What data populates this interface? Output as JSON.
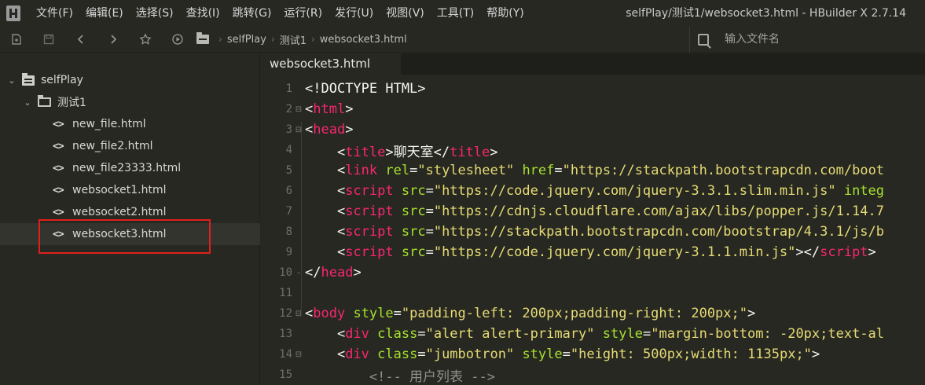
{
  "menubar": {
    "items": [
      "文件(F)",
      "编辑(E)",
      "选择(S)",
      "查找(I)",
      "跳转(G)",
      "运行(R)",
      "发行(U)",
      "视图(V)",
      "工具(T)",
      "帮助(Y)"
    ],
    "window_title": "selfPlay/测试1/websocket3.html - HBuilder X 2.7.14"
  },
  "toolbar": {
    "breadcrumbs": [
      "selfPlay",
      "测试1",
      "websocket3.html"
    ],
    "search_placeholder": "输入文件名"
  },
  "sidebar": {
    "project": "selfPlay",
    "folder": "测试1",
    "files": [
      "new_file.html",
      "new_file2.html",
      "new_file23333.html",
      "websocket1.html",
      "websocket2.html",
      "websocket3.html"
    ],
    "selected_file": "websocket3.html"
  },
  "editor": {
    "tab_label": "websocket3.html",
    "lines": [
      {
        "n": "1",
        "fold": "",
        "tokens": [
          [
            "doc",
            "<!DOCTYPE HTML>"
          ]
        ]
      },
      {
        "n": "2",
        "fold": "⊟",
        "tokens": [
          [
            "txt",
            "<"
          ],
          [
            "tag",
            "html"
          ],
          [
            "txt",
            ">"
          ]
        ]
      },
      {
        "n": "3",
        "fold": "⊟",
        "tokens": [
          [
            "txt",
            "<"
          ],
          [
            "tag",
            "head"
          ],
          [
            "txt",
            ">"
          ]
        ]
      },
      {
        "n": "4",
        "fold": "",
        "tokens": [
          [
            "txt",
            "    <"
          ],
          [
            "tag",
            "title"
          ],
          [
            "txt",
            ">聊天室</"
          ],
          [
            "tag",
            "title"
          ],
          [
            "txt",
            ">"
          ]
        ]
      },
      {
        "n": "5",
        "fold": "",
        "tokens": [
          [
            "txt",
            "    <"
          ],
          [
            "tag",
            "link"
          ],
          [
            "txt",
            " "
          ],
          [
            "attr",
            "rel"
          ],
          [
            "txt",
            "="
          ],
          [
            "str",
            "\"stylesheet\""
          ],
          [
            "txt",
            " "
          ],
          [
            "attr",
            "href"
          ],
          [
            "txt",
            "="
          ],
          [
            "str",
            "\"https://stackpath.bootstrapcdn.com/boot"
          ]
        ]
      },
      {
        "n": "6",
        "fold": "",
        "tokens": [
          [
            "txt",
            "    <"
          ],
          [
            "tag",
            "script"
          ],
          [
            "txt",
            " "
          ],
          [
            "attr",
            "src"
          ],
          [
            "txt",
            "="
          ],
          [
            "str",
            "\"https://code.jquery.com/jquery-3.3.1.slim.min.js\""
          ],
          [
            "txt",
            " "
          ],
          [
            "attr",
            "integ"
          ]
        ]
      },
      {
        "n": "7",
        "fold": "",
        "tokens": [
          [
            "txt",
            "    <"
          ],
          [
            "tag",
            "script"
          ],
          [
            "txt",
            " "
          ],
          [
            "attr",
            "src"
          ],
          [
            "txt",
            "="
          ],
          [
            "str",
            "\"https://cdnjs.cloudflare.com/ajax/libs/popper.js/1.14.7"
          ]
        ]
      },
      {
        "n": "8",
        "fold": "",
        "tokens": [
          [
            "txt",
            "    <"
          ],
          [
            "tag",
            "script"
          ],
          [
            "txt",
            " "
          ],
          [
            "attr",
            "src"
          ],
          [
            "txt",
            "="
          ],
          [
            "str",
            "\"https://stackpath.bootstrapcdn.com/bootstrap/4.3.1/js/b"
          ]
        ]
      },
      {
        "n": "9",
        "fold": "",
        "tokens": [
          [
            "txt",
            "    <"
          ],
          [
            "tag",
            "script"
          ],
          [
            "txt",
            " "
          ],
          [
            "attr",
            "src"
          ],
          [
            "txt",
            "="
          ],
          [
            "str",
            "\"https://code.jquery.com/jquery-3.1.1.min.js\""
          ],
          [
            "txt",
            "></"
          ],
          [
            "tag",
            "script"
          ],
          [
            "txt",
            ">"
          ]
        ]
      },
      {
        "n": "10",
        "fold": "-",
        "tokens": [
          [
            "txt",
            "</"
          ],
          [
            "tag",
            "head"
          ],
          [
            "txt",
            ">"
          ]
        ]
      },
      {
        "n": "11",
        "fold": "",
        "tokens": []
      },
      {
        "n": "12",
        "fold": "⊟",
        "tokens": [
          [
            "txt",
            "<"
          ],
          [
            "tag",
            "body"
          ],
          [
            "txt",
            " "
          ],
          [
            "attr",
            "style"
          ],
          [
            "txt",
            "="
          ],
          [
            "str",
            "\"padding-left: 200px;padding-right: 200px;\""
          ],
          [
            "txt",
            ">"
          ]
        ]
      },
      {
        "n": "13",
        "fold": "",
        "tokens": [
          [
            "txt",
            "    <"
          ],
          [
            "tag",
            "div"
          ],
          [
            "txt",
            " "
          ],
          [
            "attr",
            "class"
          ],
          [
            "txt",
            "="
          ],
          [
            "str",
            "\"alert alert-primary\""
          ],
          [
            "txt",
            " "
          ],
          [
            "attr",
            "style"
          ],
          [
            "txt",
            "="
          ],
          [
            "str",
            "\"margin-bottom: -20px;text-al"
          ]
        ]
      },
      {
        "n": "14",
        "fold": "⊟",
        "tokens": [
          [
            "txt",
            "    <"
          ],
          [
            "tag",
            "div"
          ],
          [
            "txt",
            " "
          ],
          [
            "attr",
            "class"
          ],
          [
            "txt",
            "="
          ],
          [
            "str",
            "\"jumbotron\""
          ],
          [
            "txt",
            " "
          ],
          [
            "attr",
            "style"
          ],
          [
            "txt",
            "="
          ],
          [
            "str",
            "\"height: 500px;width: 1135px;\""
          ],
          [
            "txt",
            ">"
          ]
        ]
      },
      {
        "n": "15",
        "fold": "",
        "tokens": [
          [
            "com",
            "        <!-- 用户列表 -->"
          ]
        ]
      }
    ]
  }
}
